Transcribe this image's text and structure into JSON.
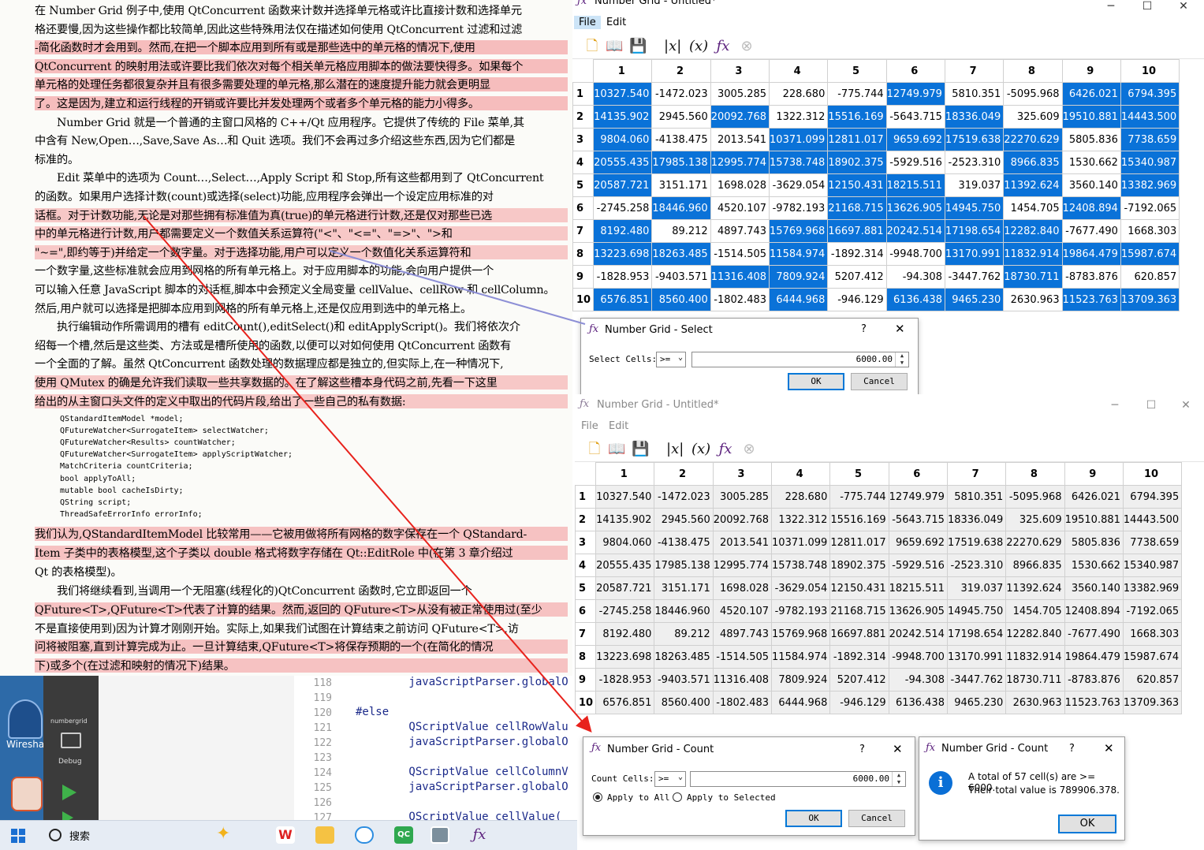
{
  "book": {
    "lines": [
      "在 Number Grid 例子中,使用 QtConcurrent 函数来计数并选择单元格或许比直接计数和选择单元",
      "格还要慢,因为这些操作都比较简单,因此这些特殊用法仅在描述如何使用 QtConcurrent 过滤和过滤",
      "-简化函数时才会用到。然而,在把一个脚本应用到所有或是那些选中的单元格的情况下,使用",
      "QtConcurrent 的映射用法或许要比我们依次对每个相关单元格应用脚本的做法要快得多。如果每个",
      "单元格的处理任务都很复杂并且有很多需要处理的单元格,那么潜在的速度提升能力就会更明显",
      "了。这是因为,建立和运行线程的开销或许要比并发处理两个或者多个单元格的能力小得多。",
      "　　Number Grid 就是一个普通的主窗口风格的 C++/Qt 应用程序。它提供了传统的 File 菜单,其",
      "中含有 New,Open…,Save,Save As…和 Quit 选项。我们不会再过多介绍这些东西,因为它们都是",
      "标准的。",
      "　　Edit 菜单中的选项为 Count…,Select…,Apply Script 和 Stop,所有这些都用到了 QtConcurrent",
      "的函数。如果用户选择计数(count)或选择(select)功能,应用程序会弹出一个设定应用标准的对",
      "话框。对于计数功能,无论是对那些拥有标准值为真(true)的单元格进行计数,还是仅对那些已选",
      "中的单元格进行计数,用户都需要定义一个数值关系运算符(\"<\"、\"<=\"、\"=>\"、\">和",
      "\"~=\",即约等于)并给定一个数字量。对于选择功能,用户可以定义一个数值化关系运算符和",
      "一个数字量,这些标准就会应用到网格的所有单元格上。对于应用脚本的功能,会向用户提供一个",
      "可以输入任意 JavaScript 脚本的对话框,脚本中会预定义全局变量 cellValue、cellRow 和 cellColumn。",
      "然后,用户就可以选择是把脚本应用到网格的所有单元格上,还是仅应用到选中的单元格上。",
      "　　执行编辑动作所需调用的槽有 editCount(),editSelect()和 editApplyScript()。我们将依次介",
      "绍每一个槽,然后是这些类、方法或是槽所使用的函数,以便可以对如何使用 QtConcurrent 函数有",
      "一个全面的了解。虽然 QtConcurrent 函数处理的数据理应都是独立的,但实际上,在一种情况下,",
      "使用 QMutex 的确是允许我们读取一些共享数据的。在了解这些槽本身代码之前,先看一下这里",
      "给出的从主窗口头文件的定义中取出的代码片段,给出了一些自己的私有数据:"
    ],
    "code": [
      "QStandardItemModel *model;",
      "QFutureWatcher<SurrogateItem> selectWatcher;",
      "QFutureWatcher<Results> countWatcher;",
      "QFutureWatcher<SurrogateItem> applyScriptWatcher;",
      "MatchCriteria countCriteria;",
      "bool applyToAll;",
      "mutable bool cacheIsDirty;",
      "QString script;",
      "ThreadSafeErrorInfo errorInfo;"
    ],
    "lines2": [
      "我们认为,QStandardItemModel 比较常用——它被用做将所有网格的数字保存在一个 QStandard-",
      "Item 子类中的表格模型,这个子类以 double 格式将数字存储在 Qt::EditRole 中(在第 3 章介绍过",
      "Qt 的表格模型)。",
      "　　我们将继续看到,当调用一个无阻塞(线程化的)QtConcurrent 函数时,它立即返回一个",
      "QFuture<T>,QFuture<T>代表了计算的结果。然而,返回的 QFuture<T>从没有被正常使用过(至少",
      "不是直接使用到)因为计算才刚刚开始。实际上,如果我们试图在计算结束之前访问 QFuture<T>,访",
      "问将被阻塞,直到计算完成为止。一旦计算结束,QFuture<T>将保存预期的一个(在简化的情况",
      "下)或多个(在过滤和映射的情况下)结果。"
    ]
  },
  "desktop": {
    "wireshark_label": "Wiresha",
    "debug_project": "numbergrid",
    "debug_label": "Debug"
  },
  "editor": {
    "lines": [
      {
        "n": "118",
        "code": "        javaScriptParser.globalO"
      },
      {
        "n": "119",
        "code": ""
      },
      {
        "n": "120",
        "code": "#else"
      },
      {
        "n": "121",
        "code": "        QScriptValue cellRowValu"
      },
      {
        "n": "122",
        "code": "        javaScriptParser.globalO"
      },
      {
        "n": "123",
        "code": ""
      },
      {
        "n": "124",
        "code": "        QScriptValue cellColumnV"
      },
      {
        "n": "125",
        "code": "        javaScriptParser.globalO"
      },
      {
        "n": "126",
        "code": ""
      },
      {
        "n": "127",
        "code": "        QScriptValue cellValue("
      }
    ]
  },
  "taskbar": {
    "search_label": "搜索"
  },
  "window1": {
    "title": "Number Grid - Untitled*",
    "menus": [
      "File",
      "Edit"
    ]
  },
  "window2": {
    "title": "Number Grid - Untitled*",
    "menus": [
      "File",
      "Edit"
    ]
  },
  "grid": {
    "columns": [
      "1",
      "2",
      "3",
      "4",
      "5",
      "6",
      "7",
      "8",
      "9",
      "10"
    ],
    "rows": [
      [
        "10327.540",
        "-1472.023",
        "3005.285",
        "228.680",
        "-775.744",
        "12749.979",
        "5810.351",
        "-5095.968",
        "6426.021",
        "6794.395"
      ],
      [
        "14135.902",
        "2945.560",
        "20092.768",
        "1322.312",
        "15516.169",
        "-5643.715",
        "18336.049",
        "325.609",
        "19510.881",
        "14443.500"
      ],
      [
        "9804.060",
        "-4138.475",
        "2013.541",
        "10371.099",
        "12811.017",
        "9659.692",
        "17519.638",
        "22270.629",
        "5805.836",
        "7738.659"
      ],
      [
        "20555.435",
        "17985.138",
        "12995.774",
        "15738.748",
        "18902.375",
        "-5929.516",
        "-2523.310",
        "8966.835",
        "1530.662",
        "15340.987"
      ],
      [
        "20587.721",
        "3151.171",
        "1698.028",
        "-3629.054",
        "12150.431",
        "18215.511",
        "319.037",
        "11392.624",
        "3560.140",
        "13382.969"
      ],
      [
        "-2745.258",
        "18446.960",
        "4520.107",
        "-9782.193",
        "21168.715",
        "13626.905",
        "14945.750",
        "1454.705",
        "12408.894",
        "-7192.065"
      ],
      [
        "8192.480",
        "89.212",
        "4897.743",
        "15769.968",
        "16697.881",
        "20242.514",
        "17198.654",
        "12282.840",
        "-7677.490",
        "1668.303"
      ],
      [
        "13223.698",
        "18263.485",
        "-1514.505",
        "11584.974",
        "-1892.314",
        "-9948.700",
        "13170.991",
        "11832.914",
        "19864.479",
        "15987.674"
      ],
      [
        "-1828.953",
        "-9403.571",
        "11316.408",
        "7809.924",
        "5207.412",
        "-94.308",
        "-3447.762",
        "18730.711",
        "-8783.876",
        "620.857"
      ],
      [
        "6576.851",
        "8560.400",
        "-1802.483",
        "6444.968",
        "-946.129",
        "6136.438",
        "9465.230",
        "2630.963",
        "11523.763",
        "13709.363"
      ]
    ],
    "selected": [
      [
        1,
        0,
        0,
        0,
        0,
        1,
        0,
        0,
        1,
        1
      ],
      [
        1,
        0,
        1,
        0,
        1,
        0,
        1,
        0,
        1,
        1
      ],
      [
        1,
        0,
        0,
        1,
        1,
        1,
        1,
        1,
        0,
        1
      ],
      [
        1,
        1,
        1,
        1,
        1,
        0,
        0,
        1,
        0,
        1
      ],
      [
        1,
        0,
        0,
        0,
        1,
        1,
        0,
        1,
        0,
        1
      ],
      [
        0,
        1,
        0,
        0,
        1,
        1,
        1,
        0,
        1,
        0
      ],
      [
        1,
        0,
        0,
        1,
        1,
        1,
        1,
        1,
        0,
        0
      ],
      [
        1,
        1,
        0,
        1,
        0,
        0,
        1,
        1,
        1,
        1
      ],
      [
        0,
        0,
        1,
        1,
        0,
        0,
        0,
        1,
        0,
        0
      ],
      [
        1,
        1,
        0,
        1,
        0,
        1,
        1,
        0,
        1,
        1
      ]
    ]
  },
  "select_dialog": {
    "title": "Number Grid - Select",
    "help": "?",
    "label": "Select Cells:",
    "operator": ">=",
    "value": "6000.00",
    "ok": "OK",
    "cancel": "Cancel"
  },
  "count_dialog": {
    "title": "Number Grid - Count",
    "help": "?",
    "label": "Count Cells:",
    "operator": ">=",
    "value": "6000.00",
    "apply_all": "Apply to All",
    "apply_selected": "Apply to Selected",
    "ok": "OK",
    "cancel": "Cancel"
  },
  "result_dialog": {
    "title": "Number Grid - Count",
    "help": "?",
    "line1": "A total of 57 cell(s) are >= 6000.",
    "line2": "Their total value is 789906.378.",
    "ok": "OK"
  },
  "colors": {
    "highlight_red": "#f28a8c",
    "selection_blue": "#0a72d8",
    "annotation_arrow": "#e8221c",
    "annotation_line": "#8d8fd6"
  }
}
